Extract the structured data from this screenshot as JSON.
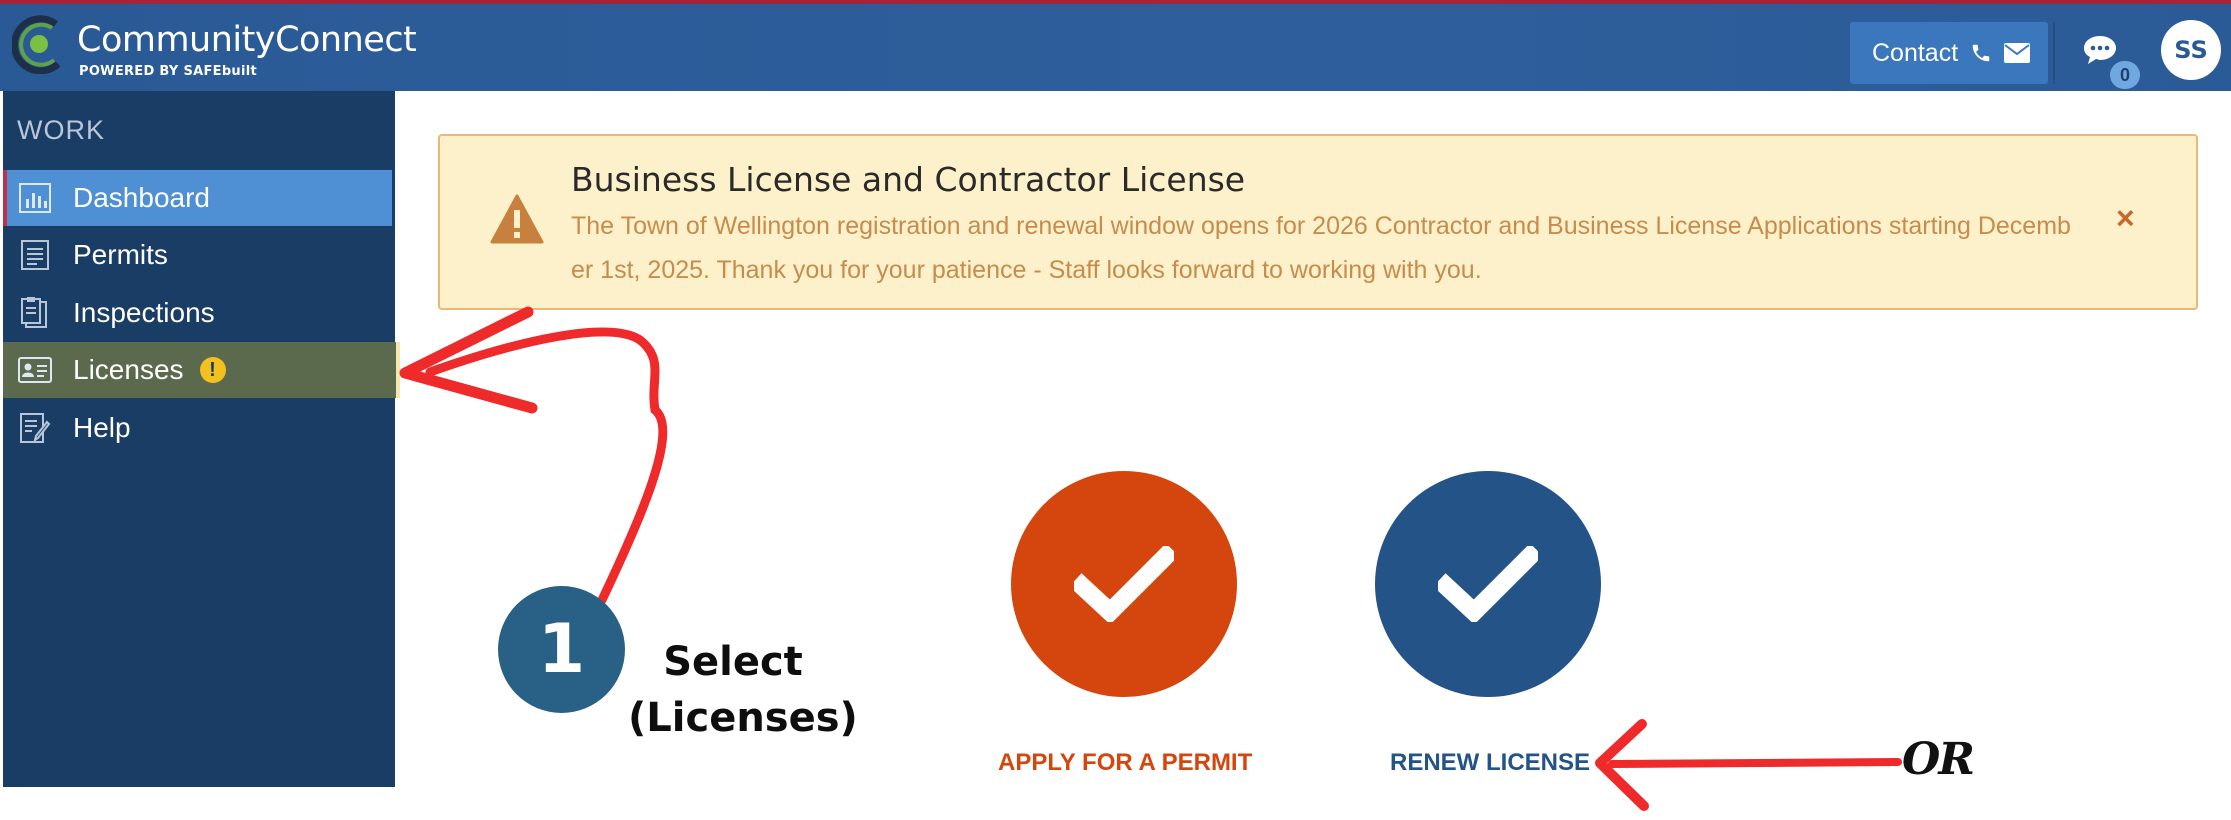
{
  "header": {
    "app_title": "CommunityConnect",
    "app_subtitle": "POWERED BY SAFEbuilt",
    "contact_label": "Contact",
    "chat_count": "0",
    "user_initials": "SS"
  },
  "sidebar": {
    "heading": "WORK",
    "items": [
      {
        "label": "Dashboard",
        "icon": "bar-chart-icon"
      },
      {
        "label": "Permits",
        "icon": "document-icon"
      },
      {
        "label": "Inspections",
        "icon": "clipboard-icon"
      },
      {
        "label": "Licenses",
        "icon": "id-card-icon"
      },
      {
        "label": "Help",
        "icon": "edit-document-icon"
      }
    ]
  },
  "alert": {
    "title": "Business License and Contractor License",
    "body": "The Town of Wellington registration and renewal window opens for 2026 Contractor and Business License Applications starting December 1st, 2025. Thank you for your patience - Staff looks forward to working with you.",
    "close": "×"
  },
  "actions": {
    "apply_label": "APPLY FOR A PERMIT",
    "renew_label": "RENEW LICENSE"
  },
  "annotations": {
    "step_number": "1",
    "step_line1": "Select",
    "step_line2": "(Licenses)",
    "or_text": "OR"
  },
  "colors": {
    "header_bg": "#2a5a96",
    "sidebar_bg": "#1a3d66",
    "active_item": "#4f8fd4",
    "apply_orange": "#d4460d",
    "renew_blue": "#245388",
    "alert_bg": "#fdf1cb",
    "arrow_red": "#ee2a2a"
  }
}
